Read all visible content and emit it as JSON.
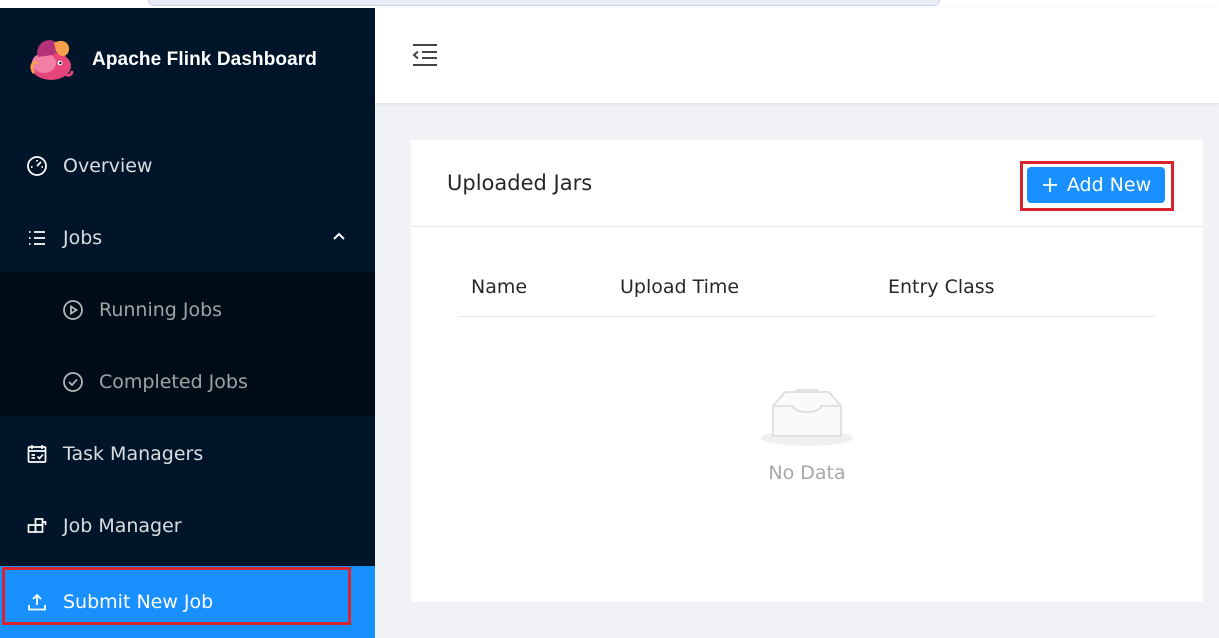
{
  "app": {
    "title": "Apache Flink Dashboard"
  },
  "sidebar": {
    "items": [
      {
        "label": "Overview",
        "icon": "dashboard-icon"
      },
      {
        "label": "Jobs",
        "icon": "list-icon",
        "expanded": true
      },
      {
        "label": "Running Jobs",
        "icon": "play-circle-icon"
      },
      {
        "label": "Completed Jobs",
        "icon": "check-circle-icon"
      },
      {
        "label": "Task Managers",
        "icon": "schedule-icon"
      },
      {
        "label": "Job Manager",
        "icon": "build-icon"
      },
      {
        "label": "Submit New Job",
        "icon": "upload-icon",
        "active": true
      }
    ]
  },
  "header": {
    "menu_fold_icon": "menu-fold-icon"
  },
  "card": {
    "title": "Uploaded Jars",
    "add_button_label": "Add New",
    "columns": [
      "Name",
      "Upload Time",
      "Entry Class"
    ],
    "empty_text": "No Data"
  },
  "colors": {
    "sidebar_bg": "#001529",
    "submenu_bg": "#000c17",
    "accent": "#1890ff",
    "highlight_box": "#d9232d"
  }
}
